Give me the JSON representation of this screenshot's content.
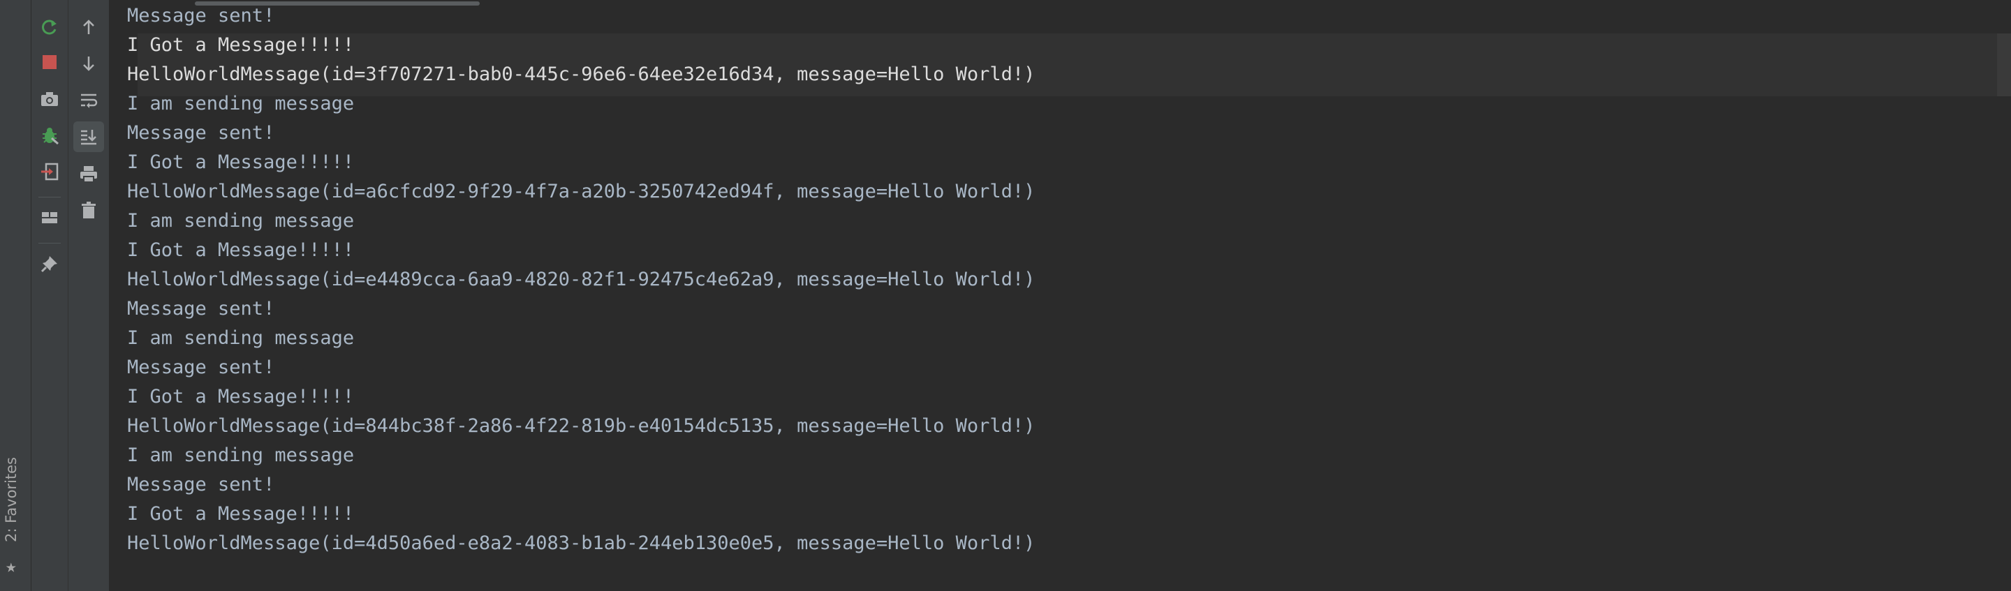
{
  "favorites": {
    "label": "2: Favorites",
    "icon": "star-icon"
  },
  "toolbar_left": [
    {
      "name": "rerun-icon",
      "color": "#499c54"
    },
    {
      "name": "stop-icon",
      "color": "#c75450"
    },
    {
      "name": "screenshot-icon",
      "color": "#afb1b3"
    },
    {
      "name": "debug-bug-icon",
      "color": "#499c54"
    },
    {
      "name": "exit-icon",
      "color": "#afb1b3"
    },
    {
      "name": "layout-icon",
      "color": "#afb1b3"
    },
    {
      "name": "pin-icon",
      "color": "#afb1b3"
    }
  ],
  "toolbar_right": [
    {
      "name": "arrow-up-icon"
    },
    {
      "name": "arrow-down-icon"
    },
    {
      "name": "soft-wrap-icon"
    },
    {
      "name": "scroll-to-end-icon"
    },
    {
      "name": "print-icon"
    },
    {
      "name": "trash-icon"
    }
  ],
  "console": {
    "lines": [
      "Message sent!",
      "I Got a Message!!!!!",
      "HelloWorldMessage(id=3f707271-bab0-445c-96e6-64ee32e16d34, message=Hello World!)",
      "I am sending message",
      "Message sent!",
      "I Got a Message!!!!!",
      "HelloWorldMessage(id=a6cfcd92-9f29-4f7a-a20b-3250742ed94f, message=Hello World!)",
      "I am sending message",
      "I Got a Message!!!!!",
      "HelloWorldMessage(id=e4489cca-6aa9-4820-82f1-92475c4e62a9, message=Hello World!)",
      "Message sent!",
      "I am sending message",
      "Message sent!",
      "I Got a Message!!!!!",
      "HelloWorldMessage(id=844bc38f-2a86-4f22-819b-e40154dc5135, message=Hello World!)",
      "I am sending message",
      "Message sent!",
      "I Got a Message!!!!!",
      "HelloWorldMessage(id=4d50a6ed-e8a2-4083-b1ab-244eb130e0e5, message=Hello World!)"
    ]
  },
  "colors": {
    "background": "#2b2b2b",
    "panel": "#3c3f41",
    "text": "#a9b7c6",
    "text_bright": "#dcdcdc",
    "run_green": "#499c54",
    "stop_red": "#c75450"
  }
}
